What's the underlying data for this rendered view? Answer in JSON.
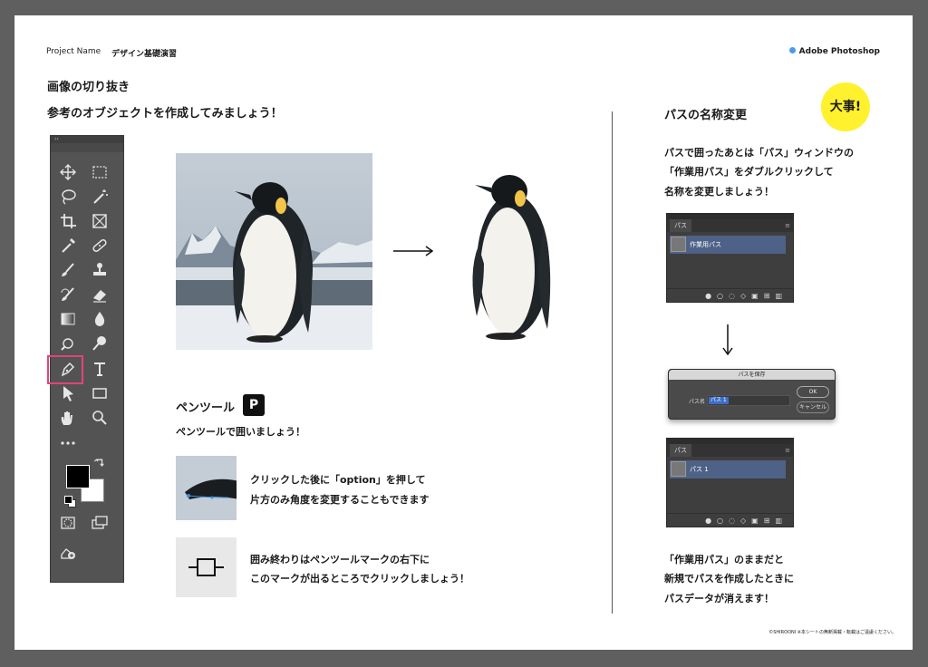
{
  "header": {
    "project_label": "Project Name",
    "project_name": "デザイン基礎演習",
    "app_name": "Adobe Photoshop",
    "app_dot_color": "#4a9be8"
  },
  "left": {
    "title": "画像の切り抜き",
    "subtitle": "参考のオブジェクトを作成してみましょう！",
    "pen_section": {
      "title": "ペンツール",
      "shortcut_key": "P",
      "subtitle": "ペンツールで囲いましょう！",
      "tip1_line1": "クリックした後に「option」を押して",
      "tip1_line2": "片方のみ角度を変更することもできます",
      "tip2_line1": "囲み終わりはペンツールマークの右下に",
      "tip2_line2": "このマークが出るところでクリックしましょう！"
    },
    "toolbar": {
      "collapse_glyph": "‹‹",
      "highlight_color": "#e0457a",
      "tools": [
        "move-tool",
        "marquee-tool",
        "lasso-tool",
        "magic-wand-tool",
        "crop-tool",
        "frame-tool",
        "eyedropper-tool",
        "healing-tool",
        "brush-tool",
        "stamp-tool",
        "history-brush-tool",
        "eraser-tool",
        "gradient-tool",
        "blur-tool",
        "dodge-tool",
        "burn-tool",
        "pen-tool",
        "type-tool",
        "path-select-tool",
        "rectangle-tool",
        "hand-tool",
        "zoom-tool",
        "more-tools"
      ]
    }
  },
  "right": {
    "title": "パスの名称変更",
    "badge": "大事!",
    "badge_color": "#fff12e",
    "intro_line1": "パスで囲ったあとは「パス」ウィンドウの",
    "intro_line2": "「作業用パス」をダブルクリックして",
    "intro_line3": "名称を変更しましょう！",
    "panel1": {
      "tab": "パス",
      "row_label": "作業用パス"
    },
    "dialog": {
      "title": "パスを保存",
      "field_label": "パス名 :",
      "field_value": "パス 1",
      "ok": "OK",
      "cancel": "キャンセル"
    },
    "panel2": {
      "tab": "パス",
      "row_label": "パス 1"
    },
    "note_line1": "「作業用パス」のままだと",
    "note_line2": "新規でパスを作成したときに",
    "note_line3": "パスデータが消えます！"
  },
  "footer": {
    "copyright": "©SHIROONI ※本シートの無断掲載・転載はご遠慮ください。"
  }
}
